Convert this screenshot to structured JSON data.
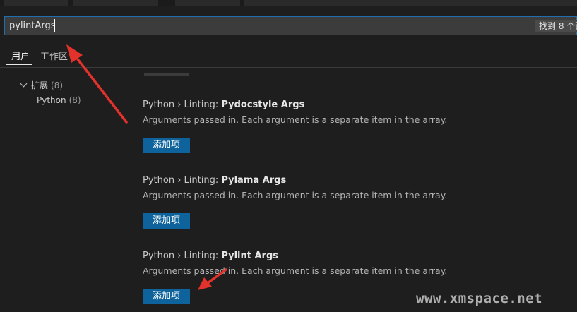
{
  "search": {
    "value": "pylintArgs",
    "results_label": "找到 8 个设"
  },
  "tabs": [
    {
      "label": "用户",
      "active": true
    },
    {
      "label": "工作区",
      "active": false
    }
  ],
  "tree": {
    "group": {
      "label": "扩展",
      "count": "(8)"
    },
    "child": {
      "label": "Python",
      "count": "(8)"
    }
  },
  "settings": [
    {
      "prefix": "Python › Linting: ",
      "key": "Pydocstyle Args",
      "description": "Arguments passed in. Each argument is a separate item in the array.",
      "button_label": "添加项"
    },
    {
      "prefix": "Python › Linting: ",
      "key": "Pylama Args",
      "description": "Arguments passed in. Each argument is a separate item in the array.",
      "button_label": "添加项"
    },
    {
      "prefix": "Python › Linting: ",
      "key": "Pylint Args",
      "description": "Arguments passed in. Each argument is a separate item in the array.",
      "button_label": "添加项"
    }
  ],
  "watermark": "www.xmspace.net",
  "colors": {
    "accent": "#0e639c",
    "annotation_arrow": "#e2322b",
    "focus_border": "#1f6fb0",
    "background": "#1e1e1e"
  },
  "icons": {
    "tree_chevron": "chevron-down-icon"
  }
}
